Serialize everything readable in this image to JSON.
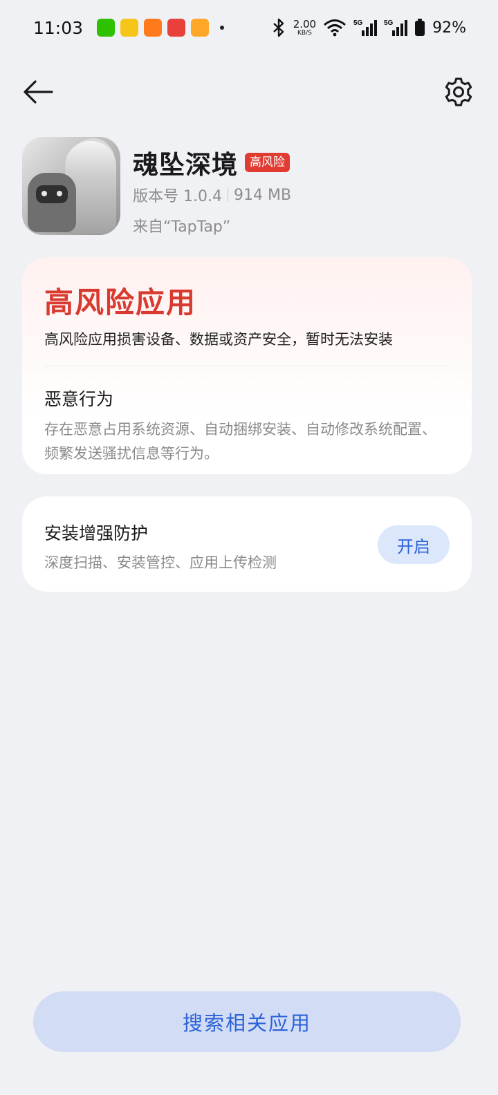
{
  "status_bar": {
    "time": "11:03",
    "speed_value": "2.00",
    "speed_unit": "KB/S",
    "battery": "92%",
    "apps": [
      {
        "name": "wechat-icon",
        "color": "#2dc100"
      },
      {
        "name": "video-app-icon",
        "color": "#f5c518"
      },
      {
        "name": "orange-app-icon",
        "color": "#ff7a1a"
      },
      {
        "name": "game-app-icon",
        "color": "#e8403a"
      },
      {
        "name": "reader-app-icon",
        "color": "#ffa726"
      }
    ]
  },
  "app": {
    "name": "魂坠深境",
    "risk_badge": "高风险",
    "version": "版本号 1.0.4",
    "size": "914 MB",
    "source": "来自“TapTap”"
  },
  "warning": {
    "title": "高风险应用",
    "description": "高风险应用损害设备、数据或资产安全，暂时无法安装",
    "behavior_title": "恶意行为",
    "behavior_description": "存在恶意占用系统资源、自动捆绑安装、自动修改系统配置、频繁发送骚扰信息等行为。"
  },
  "protection": {
    "title": "安装增强防护",
    "description": "深度扫描、安装管控、应用上传检测",
    "button": "开启"
  },
  "bottom": {
    "search_button": "搜索相关应用"
  },
  "colors": {
    "risk_red": "#d93a2f",
    "accent_blue": "#2a62d8",
    "background": "#f0f1f5"
  }
}
